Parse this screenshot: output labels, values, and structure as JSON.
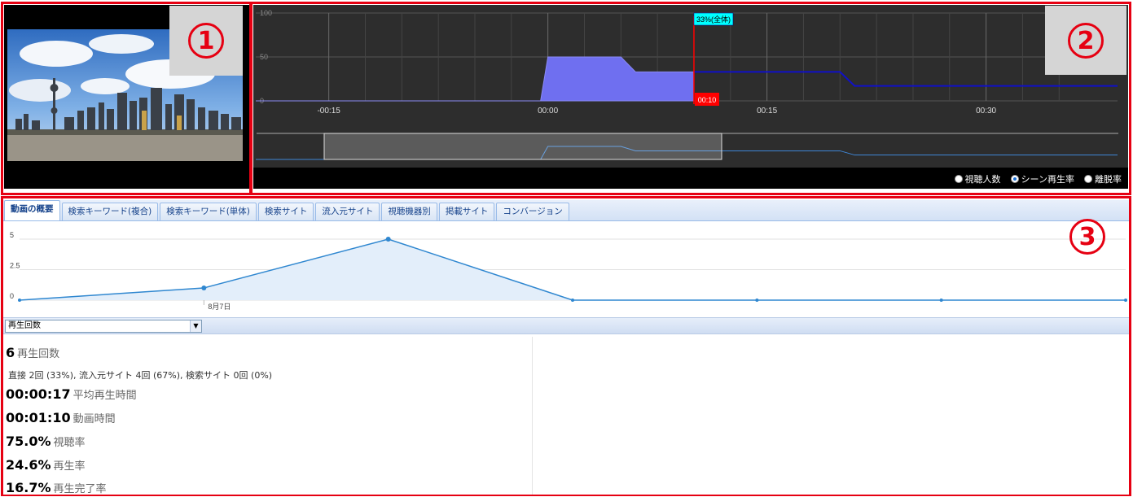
{
  "callouts": {
    "one": "1",
    "two": "2",
    "three": "3"
  },
  "colors": {
    "frame": "#e60012",
    "timeline_fill": "#6f6ff0",
    "timeline_line": "#1010c8",
    "marker": "#ff0000",
    "marker_label_bg": "#00ffff",
    "trend_line": "#2f87d0",
    "trend_fill": "#e3eefa"
  },
  "timeline": {
    "y_ticks": [
      "100",
      "50",
      "0"
    ],
    "x_ticks": [
      "-00:15",
      "00:00",
      "00:15",
      "00:30"
    ],
    "marker_time": "00:10",
    "marker_label": "33%(全体)",
    "series": [
      [
        -20,
        0
      ],
      [
        -0.5,
        0
      ],
      [
        0,
        50
      ],
      [
        5,
        50
      ],
      [
        6,
        33
      ],
      [
        10,
        33
      ],
      [
        20,
        33
      ],
      [
        21,
        17
      ],
      [
        39,
        17
      ]
    ]
  },
  "radios": [
    {
      "label": "視聴人数",
      "checked": false
    },
    {
      "label": "シーン再生率",
      "checked": true
    },
    {
      "label": "離脱率",
      "checked": false
    }
  ],
  "tabs": [
    "動画の概要",
    "検索キーワード(複合)",
    "検索キーワード(単体)",
    "検索サイト",
    "流入元サイト",
    "視聴機器別",
    "掲載サイト",
    "コンバージョン"
  ],
  "chart_data": {
    "type": "area",
    "y_ticks": [
      "5",
      "2.5",
      "0"
    ],
    "ylim": [
      0,
      5
    ],
    "categories": [
      "",
      "8月7日",
      "",
      "",
      "",
      "",
      ""
    ],
    "values": [
      0,
      1,
      5,
      0,
      0,
      0,
      0
    ]
  },
  "metric_select": {
    "value": "再生回数"
  },
  "summary": {
    "plays_value": "6",
    "plays_label": "再生回数",
    "breakdown": "直接 2回 (33%), 流入元サイト 4回 (67%), 検索サイト 0回 (0%)",
    "avg_time_value": "00:00:17",
    "avg_time_label": "平均再生時間",
    "duration_value": "00:01:10",
    "duration_label": "動画時間",
    "view_rate_value": "75.0%",
    "view_rate_label": "視聴率",
    "play_rate_value": "24.6%",
    "play_rate_label": "再生率",
    "complete_rate_value": "16.7%",
    "complete_rate_label": "再生完了率"
  }
}
